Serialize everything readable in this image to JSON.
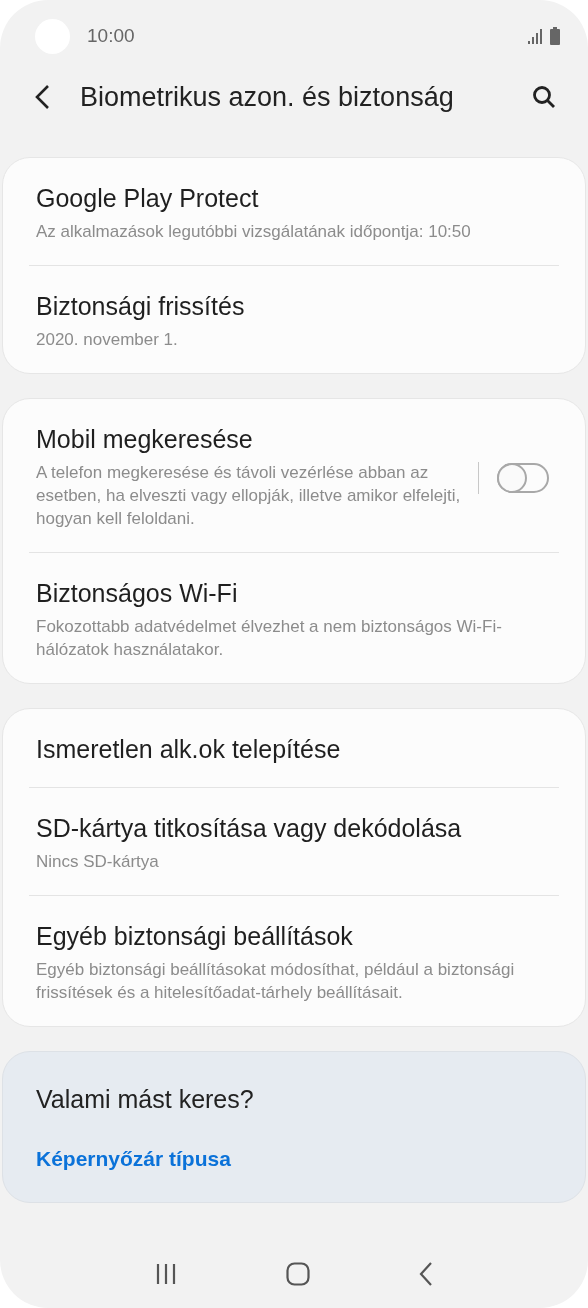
{
  "status_bar": {
    "time": "10:00"
  },
  "header": {
    "title": "Biometrikus azon. és biztonság"
  },
  "groups": [
    {
      "items": [
        {
          "kind": "text",
          "title": "Google Play Protect",
          "subtitle": "Az alkalmazások legutóbbi vizsgálatának időpontja: 10:50"
        },
        {
          "kind": "text",
          "title": "Biztonsági frissítés",
          "subtitle": "2020. november 1."
        }
      ]
    },
    {
      "items": [
        {
          "kind": "switch",
          "title": "Mobil megkeresése",
          "subtitle": "A telefon megkeresése és távoli vezérlése abban az esetben, ha elveszti vagy ellopják, illetve amikor elfelejti, hogyan kell feloldani.",
          "on": false
        },
        {
          "kind": "text",
          "title": "Biztonságos Wi-Fi",
          "subtitle": "Fokozottabb adatvédelmet élvezhet a nem biztonságos Wi-Fi-hálózatok használatakor."
        }
      ]
    },
    {
      "items": [
        {
          "kind": "text",
          "title": "Ismeretlen alk.ok telepítése"
        },
        {
          "kind": "text",
          "title": "SD-kártya titkosítása vagy dekódolása",
          "subtitle": "Nincs SD-kártya"
        },
        {
          "kind": "text",
          "title": "Egyéb biztonsági beállítások",
          "subtitle": "Egyéb biztonsági beállításokat módosíthat, például a biztonsági frissítések és a hitelesítőadat-tárhely beállításait."
        }
      ]
    }
  ],
  "suggestions": {
    "title": "Valami mást keres?",
    "links": [
      "Képernyőzár típusa"
    ]
  }
}
